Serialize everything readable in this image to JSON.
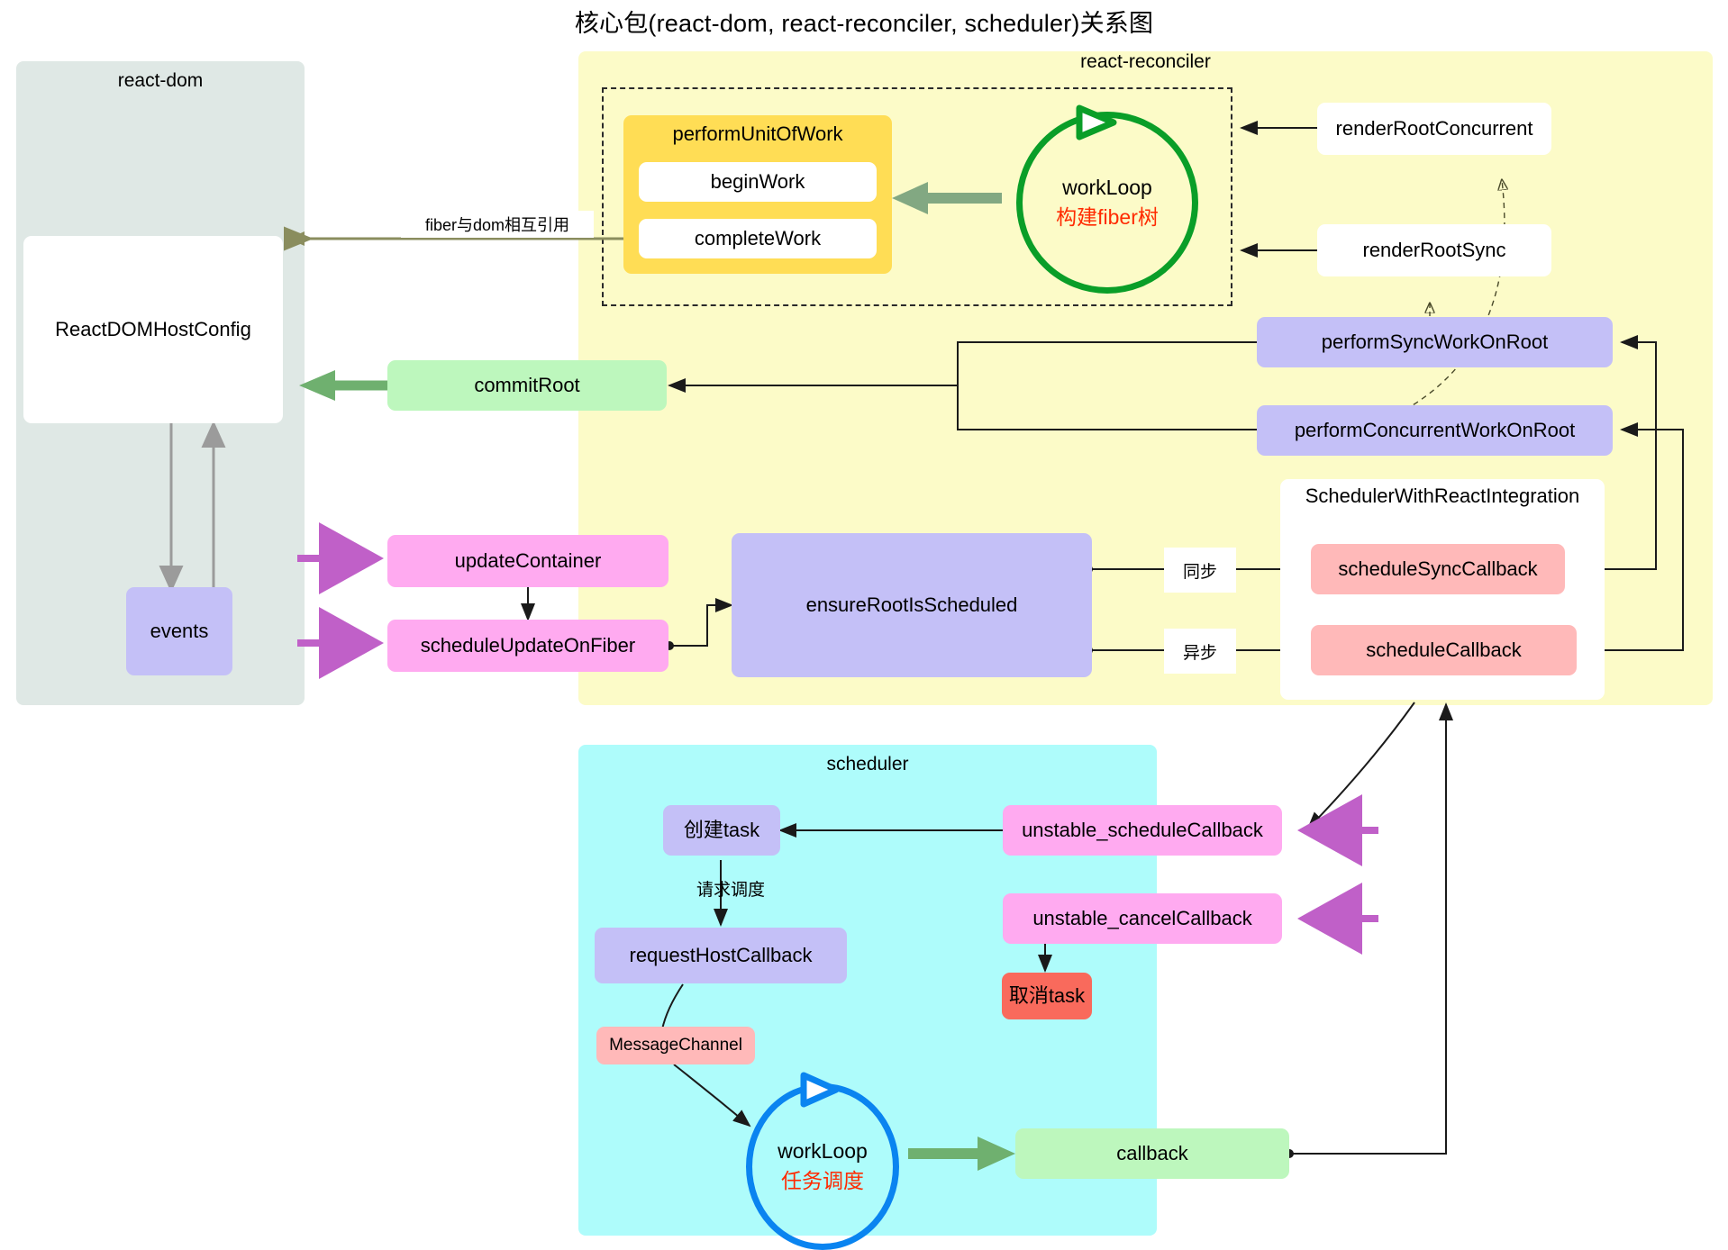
{
  "title": "核心包(react-dom, react-reconciler, scheduler)关系图",
  "packages": {
    "react_dom": {
      "label": "react-dom"
    },
    "react_reconciler": {
      "label": "react-reconciler"
    },
    "scheduler": {
      "label": "scheduler"
    }
  },
  "nodes": {
    "react_dom_host_config": "ReactDOMHostConfig",
    "events": "events",
    "perform_unit_of_work": "performUnitOfWork",
    "begin_work": "beginWork",
    "complete_work": "completeWork",
    "work_loop_fiber_title": "workLoop",
    "work_loop_fiber_sub": "构建fiber树",
    "render_root_concurrent": "renderRootConcurrent",
    "render_root_sync": "renderRootSync",
    "perform_sync_work_on_root": "performSyncWorkOnRoot",
    "perform_concurrent_work_on_root": "performConcurrentWorkOnRoot",
    "commit_root": "commitRoot",
    "update_container": "updateContainer",
    "schedule_update_on_fiber": "scheduleUpdateOnFiber",
    "ensure_root_is_scheduled": "ensureRootIsScheduled",
    "scheduler_with_react_integration": "SchedulerWithReactIntegration",
    "schedule_sync_callback": "scheduleSyncCallback",
    "schedule_callback": "scheduleCallback",
    "create_task": "创建task",
    "request_host_callback": "requestHostCallback",
    "message_channel": "MessageChannel",
    "work_loop_task_title": "workLoop",
    "work_loop_task_sub": "任务调度",
    "callback": "callback",
    "unstable_schedule_callback": "unstable_scheduleCallback",
    "unstable_cancel_callback": "unstable_cancelCallback",
    "cancel_task": "取消task"
  },
  "edge_labels": {
    "fiber_dom_ref": "fiber与dom相互引用",
    "sync": "同步",
    "async": "异步",
    "request_schedule": "请求调度"
  },
  "colors": {
    "react_dom_bg": "#dfe8e5",
    "reconciler_bg": "#fcfbc8",
    "scheduler_bg": "#aefcfb",
    "yellow_node": "#ffdd55",
    "purple_node": "#c4c0f7",
    "pink_node": "#ffaaf0",
    "salmon_node": "#ffb9b9",
    "green_node": "#bdf7bd",
    "red_node": "#f96a5c",
    "fiber_circle": "#0a9e28",
    "task_circle": "#0a84f0",
    "highlight_text": "#ff2a00",
    "magenta_arrow": "#c060c8",
    "olive_arrow": "#8a8d5e",
    "green_arrow": "#6fb06f"
  }
}
